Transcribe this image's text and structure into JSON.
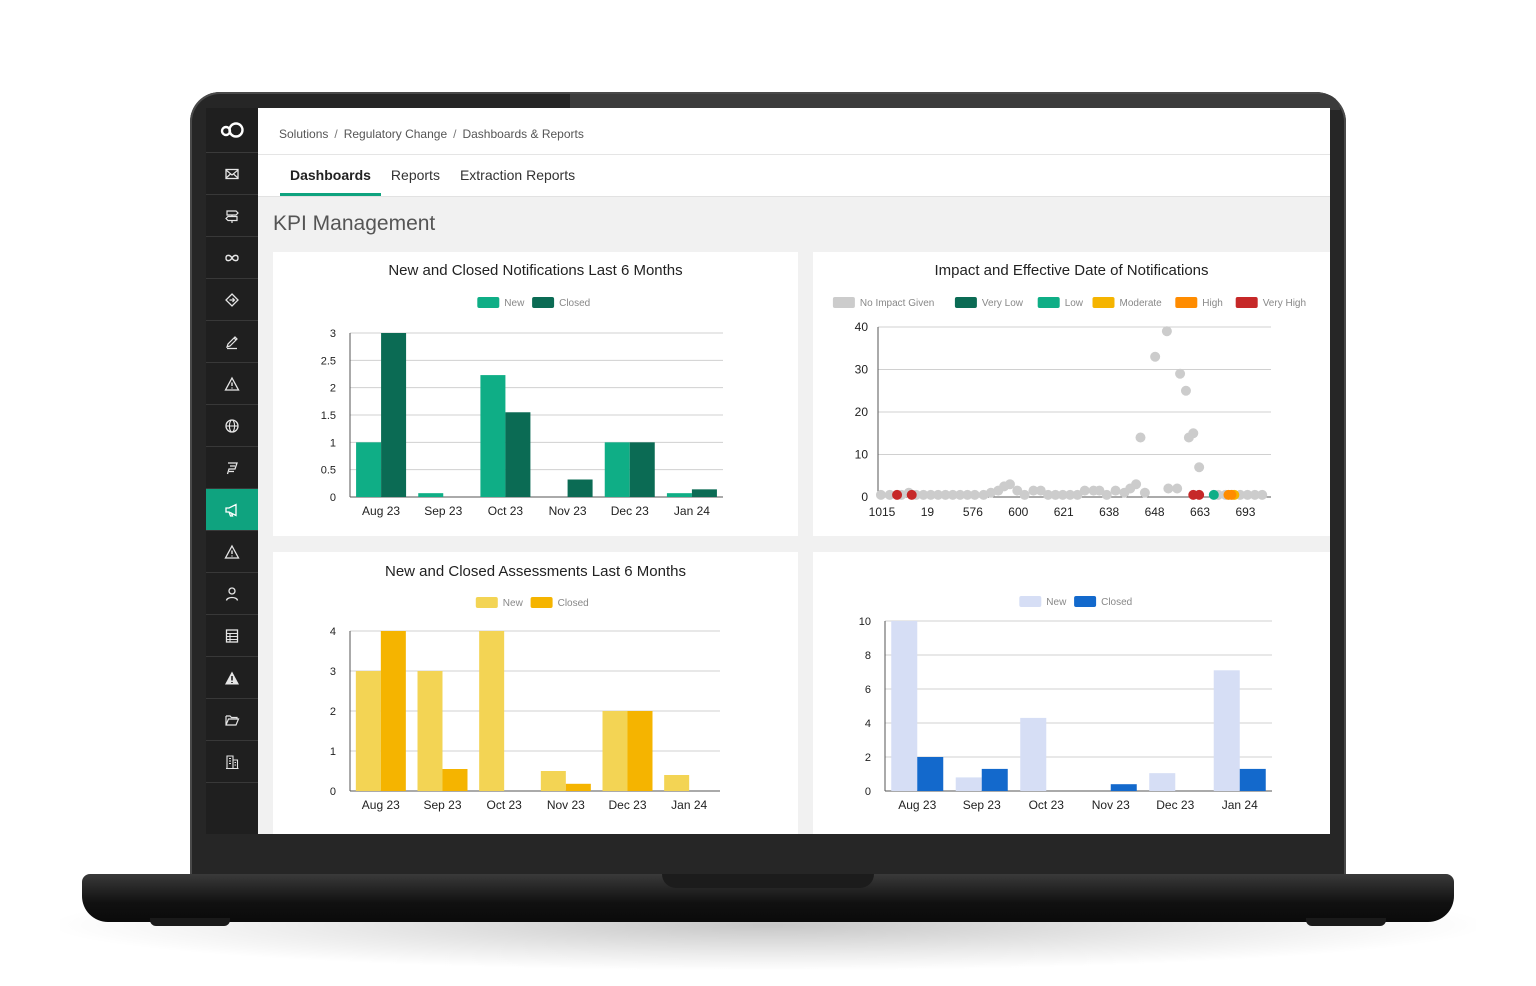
{
  "breadcrumb": [
    "Solutions",
    "Regulatory Change",
    "Dashboards & Reports"
  ],
  "tabs": [
    {
      "label": "Dashboards",
      "active": true
    },
    {
      "label": "Reports",
      "active": false
    },
    {
      "label": "Extraction Reports",
      "active": false
    }
  ],
  "page_title": "KPI Management",
  "sidebar": {
    "logo": "logo-icon",
    "items": [
      {
        "icon": "mail-icon"
      },
      {
        "icon": "signpost-icon"
      },
      {
        "icon": "infinity-icon"
      },
      {
        "icon": "diamond-icon"
      },
      {
        "icon": "pencil-icon"
      },
      {
        "icon": "warning-icon"
      },
      {
        "icon": "globe-icon"
      },
      {
        "icon": "tag-icon"
      },
      {
        "icon": "megaphone-icon",
        "active": true
      },
      {
        "icon": "warning-outline-icon"
      },
      {
        "icon": "person-icon"
      },
      {
        "icon": "table-icon"
      },
      {
        "icon": "alert-filled-icon"
      },
      {
        "icon": "folder-icon"
      },
      {
        "icon": "building-icon"
      }
    ]
  },
  "colors": {
    "accent": "#0fa37f"
  },
  "chart_data": [
    {
      "type": "bar",
      "title": "New and Closed Notifications Last 6 Months",
      "categories": [
        "Aug 23",
        "Sep 23",
        "Oct 23",
        "Nov 23",
        "Dec 23",
        "Jan 24"
      ],
      "series": [
        {
          "name": "New",
          "color": "#0fae86",
          "values": [
            1,
            0.07,
            2.23,
            0,
            1,
            0.07
          ]
        },
        {
          "name": "Closed",
          "color": "#0b6b54",
          "values": [
            3,
            0,
            1.55,
            0.32,
            1,
            0.14
          ]
        }
      ],
      "yticks": [
        "0",
        "0.5",
        "1",
        "1.5",
        "2",
        "2.5",
        "3"
      ],
      "ylim": [
        0,
        3
      ],
      "legend": "top"
    },
    {
      "type": "scatter",
      "title": "Impact and Effective Date of Notifications",
      "x_categories": [
        "1015",
        "19",
        "576",
        "600",
        "621",
        "638",
        "648",
        "663",
        "693"
      ],
      "yticks": [
        "0",
        "10",
        "20",
        "30",
        "40"
      ],
      "ylim": [
        0,
        40
      ],
      "legend": "top",
      "series": [
        {
          "name": "No Impact Given",
          "color": "#cccccc",
          "points": [
            [
              0.1,
              0.5
            ],
            [
              0.4,
              0.5
            ],
            [
              0.8,
              0.5
            ],
            [
              1.05,
              1
            ],
            [
              1.3,
              0.5
            ],
            [
              1.55,
              0.5
            ],
            [
              1.8,
              0.5
            ],
            [
              2.05,
              0.5
            ],
            [
              2.3,
              0.5
            ],
            [
              2.55,
              0.5
            ],
            [
              2.8,
              0.5
            ],
            [
              3.05,
              0.5
            ],
            [
              3.3,
              0.5
            ],
            [
              3.6,
              0.5
            ],
            [
              3.85,
              1
            ],
            [
              4.1,
              1.5
            ],
            [
              4.3,
              2.5
            ],
            [
              4.5,
              3
            ],
            [
              4.75,
              1.5
            ],
            [
              5,
              0.5
            ],
            [
              5.3,
              1.5
            ],
            [
              5.55,
              1.5
            ],
            [
              5.8,
              0.5
            ],
            [
              6.05,
              0.5
            ],
            [
              6.3,
              0.5
            ],
            [
              6.55,
              0.5
            ],
            [
              6.8,
              0.5
            ],
            [
              7.05,
              1.5
            ],
            [
              7.35,
              1.5
            ],
            [
              7.55,
              1.5
            ],
            [
              7.8,
              0.5
            ],
            [
              8.1,
              1.5
            ],
            [
              8.4,
              1
            ],
            [
              8.6,
              2
            ],
            [
              8.8,
              3
            ],
            [
              8.95,
              14
            ],
            [
              9.1,
              1
            ],
            [
              9.45,
              33
            ],
            [
              9.85,
              39
            ],
            [
              9.9,
              2
            ],
            [
              10.2,
              2
            ],
            [
              10.3,
              29
            ],
            [
              10.5,
              25
            ],
            [
              10.6,
              14
            ],
            [
              10.75,
              15
            ],
            [
              10.95,
              7
            ],
            [
              11.6,
              0.5
            ],
            [
              11.85,
              0.5
            ],
            [
              12.1,
              0.5
            ],
            [
              12.35,
              0.5
            ],
            [
              12.6,
              0.5
            ],
            [
              12.85,
              0.5
            ],
            [
              13.1,
              0.5
            ]
          ]
        },
        {
          "name": "Very Low",
          "color": "#0b6b54",
          "points": []
        },
        {
          "name": "Low",
          "color": "#0fae86",
          "points": [
            [
              11.45,
              0.5
            ]
          ]
        },
        {
          "name": "Moderate",
          "color": "#f5b400",
          "points": [
            [
              12.15,
              0.5
            ]
          ]
        },
        {
          "name": "High",
          "color": "#ff8c00",
          "points": [
            [
              11.95,
              0.5
            ],
            [
              12.05,
              0.5
            ]
          ]
        },
        {
          "name": "Very High",
          "color": "#c62828",
          "points": [
            [
              0.65,
              0.5
            ],
            [
              1.15,
              0.5
            ],
            [
              10.75,
              0.5
            ],
            [
              10.95,
              0.5
            ]
          ]
        }
      ]
    },
    {
      "type": "bar",
      "title": "New and Closed Assessments Last 6 Months",
      "categories": [
        "Aug 23",
        "Sep 23",
        "Oct 23",
        "Nov 23",
        "Dec 23",
        "Jan 24"
      ],
      "series": [
        {
          "name": "New",
          "color": "#f3d454",
          "values": [
            3,
            3,
            4,
            0.5,
            2,
            0.4
          ]
        },
        {
          "name": "Closed",
          "color": "#f5b400",
          "values": [
            4,
            0.55,
            0,
            0.18,
            2,
            0
          ]
        }
      ],
      "yticks": [
        "0",
        "1",
        "2",
        "3",
        "4"
      ],
      "ylim": [
        0,
        4
      ],
      "legend": "top"
    },
    {
      "type": "bar",
      "title": "",
      "categories": [
        "Aug 23",
        "Sep 23",
        "Oct 23",
        "Nov 23",
        "Dec 23",
        "Jan 24"
      ],
      "series": [
        {
          "name": "New",
          "color": "#d6def5",
          "values": [
            10,
            0.8,
            4.3,
            0,
            1.05,
            7.1
          ]
        },
        {
          "name": "Closed",
          "color": "#1369cc",
          "values": [
            2,
            1.3,
            0,
            0.4,
            0,
            1.3
          ]
        }
      ],
      "yticks": [
        "0",
        "2",
        "4",
        "6",
        "8",
        "10"
      ],
      "ylim": [
        0,
        10
      ],
      "legend": "top"
    }
  ]
}
